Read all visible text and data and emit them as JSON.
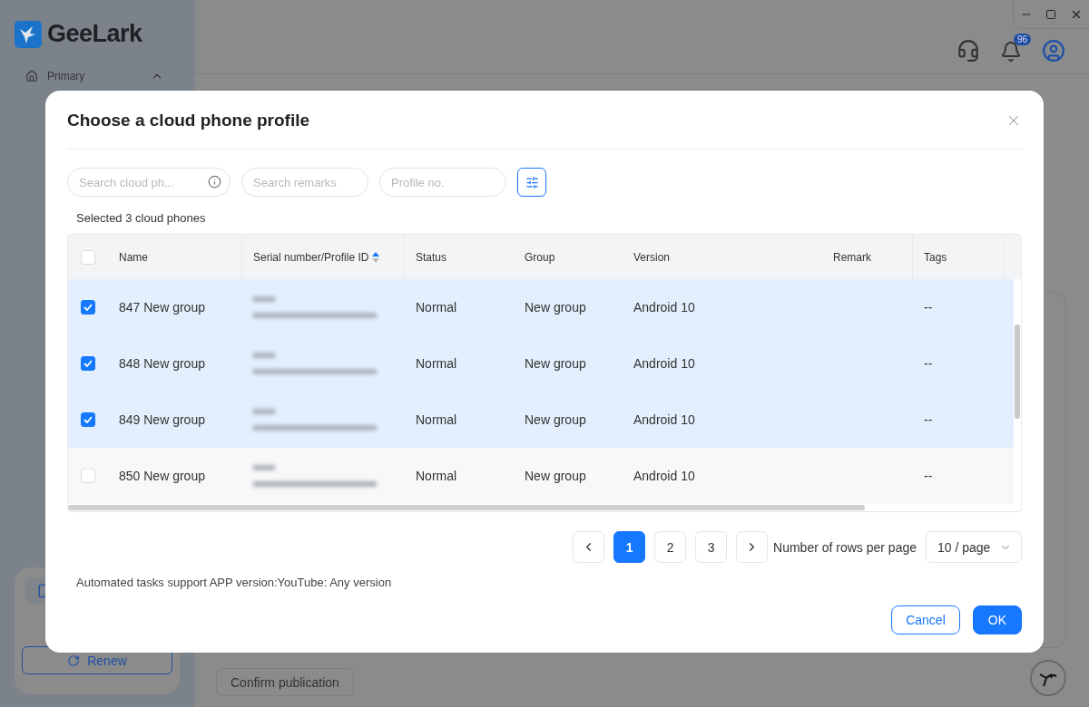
{
  "app": {
    "logo_text": "GeeLark",
    "sidebar": {
      "items": [
        {
          "label": "Primary",
          "expanded": true
        }
      ],
      "renew_button": "Renew"
    },
    "header": {
      "notification_count": "96"
    },
    "confirm_button": "Confirm publication"
  },
  "dialog": {
    "title": "Choose a cloud phone profile",
    "search_fields": [
      {
        "placeholder": "Search cloud ph...",
        "kind": "info"
      },
      {
        "placeholder": "Search remarks",
        "kind": "plain"
      },
      {
        "placeholder": "Profile no.",
        "kind": "plain"
      }
    ],
    "selected_summary": "Selected 3 cloud phones",
    "table": {
      "select_all_checked": false,
      "columns": [
        {
          "label": "Name"
        },
        {
          "label": "Serial number/Profile ID",
          "sorted_ascending": true
        },
        {
          "label": "Status"
        },
        {
          "label": "Group"
        },
        {
          "label": "Version"
        },
        {
          "label": "Remark"
        },
        {
          "label": "Tags"
        }
      ],
      "rows": [
        {
          "selected": true,
          "name": "847 New group",
          "status": "Normal",
          "group": "New group",
          "version": "Android 10",
          "tags": "--"
        },
        {
          "selected": true,
          "name": "848 New group",
          "status": "Normal",
          "group": "New group",
          "version": "Android 10",
          "tags": "--"
        },
        {
          "selected": true,
          "name": "849 New group",
          "status": "Normal",
          "group": "New group",
          "version": "Android 10",
          "tags": "--"
        },
        {
          "selected": false,
          "name": "850 New group",
          "status": "Normal",
          "group": "New group",
          "version": "Android 10",
          "tags": "--"
        }
      ]
    },
    "pagination": {
      "pages": [
        {
          "label": "1",
          "selected": true
        },
        {
          "label": "2",
          "selected": false
        },
        {
          "label": "3",
          "selected": false
        }
      ],
      "rows_per_page_label": "Number of rows per page",
      "rows_per_page_value": "10 / page"
    },
    "note": "Automated tasks support APP version:YouTube: Any version",
    "buttons": [
      {
        "label": "Cancel",
        "kind": "secondary"
      },
      {
        "label": "OK",
        "kind": "primary"
      }
    ]
  }
}
